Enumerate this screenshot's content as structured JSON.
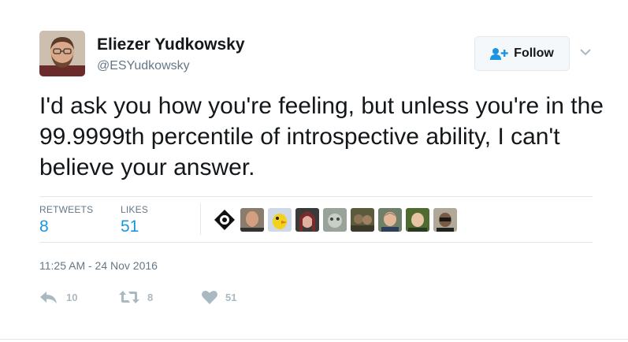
{
  "author": {
    "name": "Eliezer Yudkowsky",
    "handle": "@ESYudkowsky"
  },
  "follow_button": {
    "label": "Follow",
    "icon": "add-person-icon"
  },
  "tweet": {
    "text": "I'd ask you how you're feeling, but unless you're in the 99.9999th percentile of introspective ability, I can't believe your answer."
  },
  "stats": {
    "retweets_label": "RETWEETS",
    "retweets_value": "8",
    "likes_label": "LIKES",
    "likes_value": "51"
  },
  "likers_count": 9,
  "timestamp": "11:25 AM - 24 Nov 2016",
  "actions": {
    "reply": {
      "icon": "reply-icon",
      "count": "10"
    },
    "retweet": {
      "icon": "retweet-icon",
      "count": "8"
    },
    "like": {
      "icon": "heart-icon",
      "count": "51"
    }
  },
  "colors": {
    "link_blue": "#1b95e0",
    "muted": "#657786",
    "action_gray": "#aab8c2",
    "border": "#e1e8ed"
  }
}
